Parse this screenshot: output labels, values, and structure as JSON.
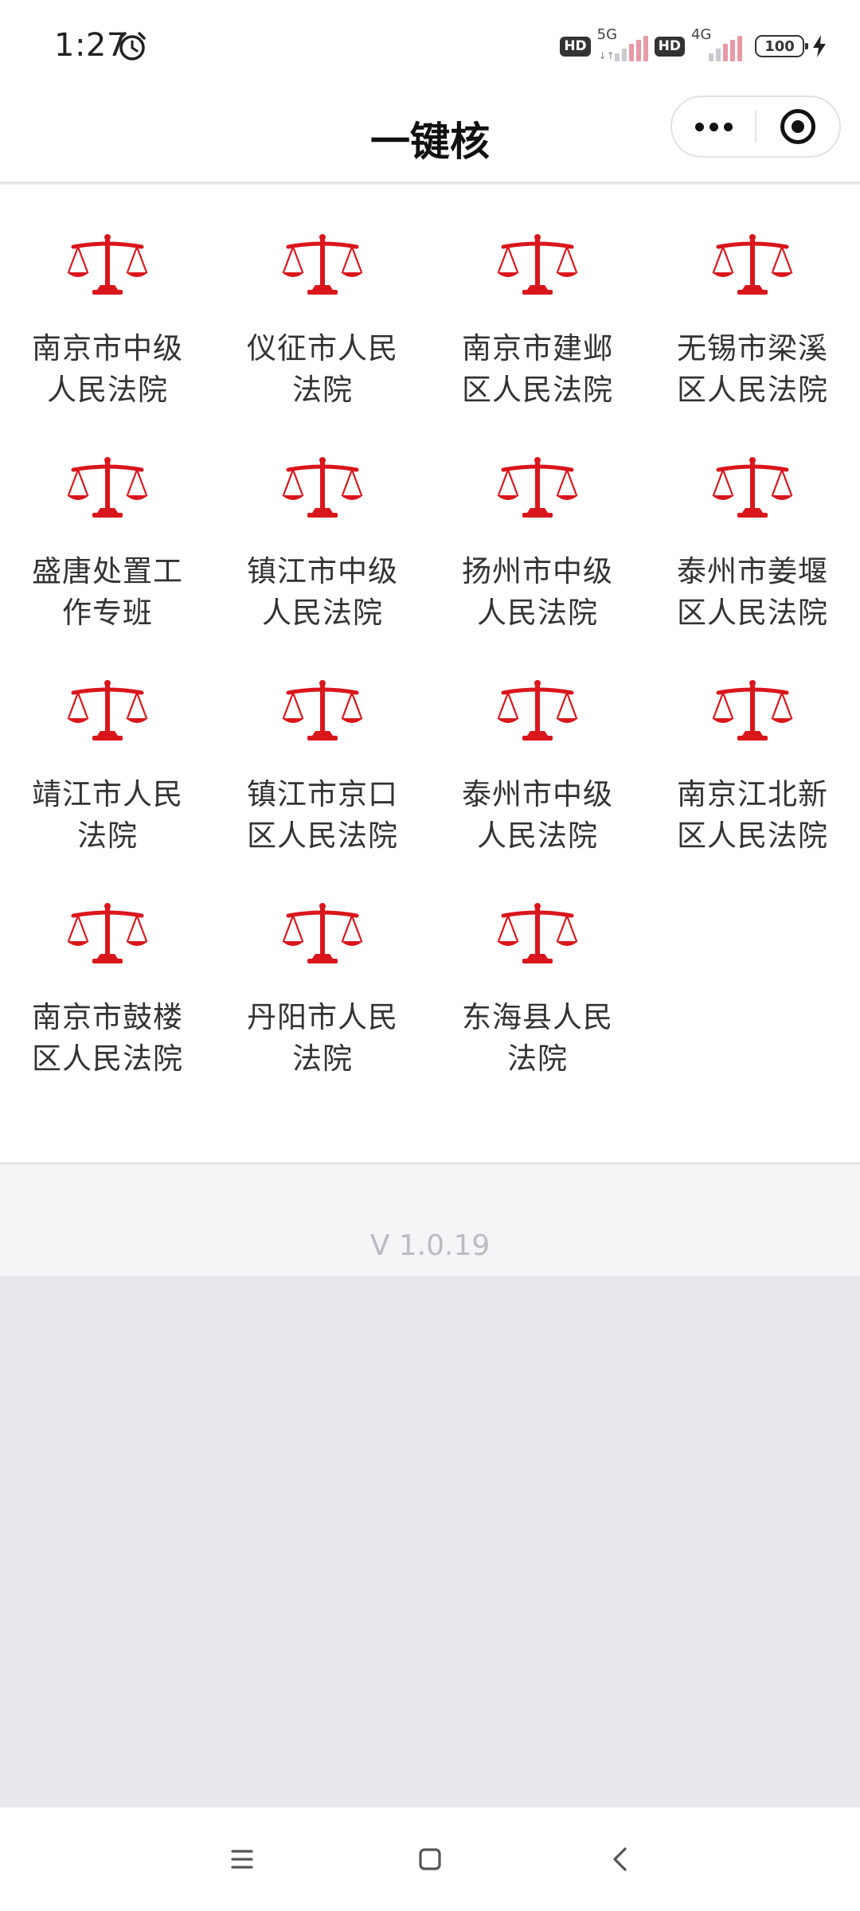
{
  "status_bar": {
    "time": "1:27",
    "hd1": "HD",
    "net1": "5G",
    "net1_arrows": "↓↑",
    "hd2": "HD",
    "net2": "4G",
    "battery": "100"
  },
  "nav": {
    "title": "一键核"
  },
  "courts": [
    {
      "name": "南京市中级人民法院"
    },
    {
      "name": "仪征市人民法院"
    },
    {
      "name": "南京市建邺区人民法院"
    },
    {
      "name": "无锡市梁溪区人民法院"
    },
    {
      "name": "盛唐处置工作专班"
    },
    {
      "name": "镇江市中级人民法院"
    },
    {
      "name": "扬州市中级人民法院"
    },
    {
      "name": "泰州市姜堰区人民法院"
    },
    {
      "name": "靖江市人民法院"
    },
    {
      "name": "镇江市京口区人民法院"
    },
    {
      "name": "泰州市中级人民法院"
    },
    {
      "name": "南京江北新区人民法院"
    },
    {
      "name": "南京市鼓楼区人民法院"
    },
    {
      "name": "丹阳市人民法院"
    },
    {
      "name": "东海县人民法院"
    }
  ],
  "version": "V 1.0.19",
  "colors": {
    "scales": "#d9161c",
    "page_bg": "#e8e8ee",
    "version_text": "#bbbbc2"
  },
  "icons": {
    "court": "scales-of-justice-icon",
    "capsule_more": "more-dots-icon",
    "capsule_close": "target-close-icon",
    "nav_menu": "menu-lines-icon",
    "nav_home": "square-home-icon",
    "nav_back": "chevron-left-icon"
  }
}
